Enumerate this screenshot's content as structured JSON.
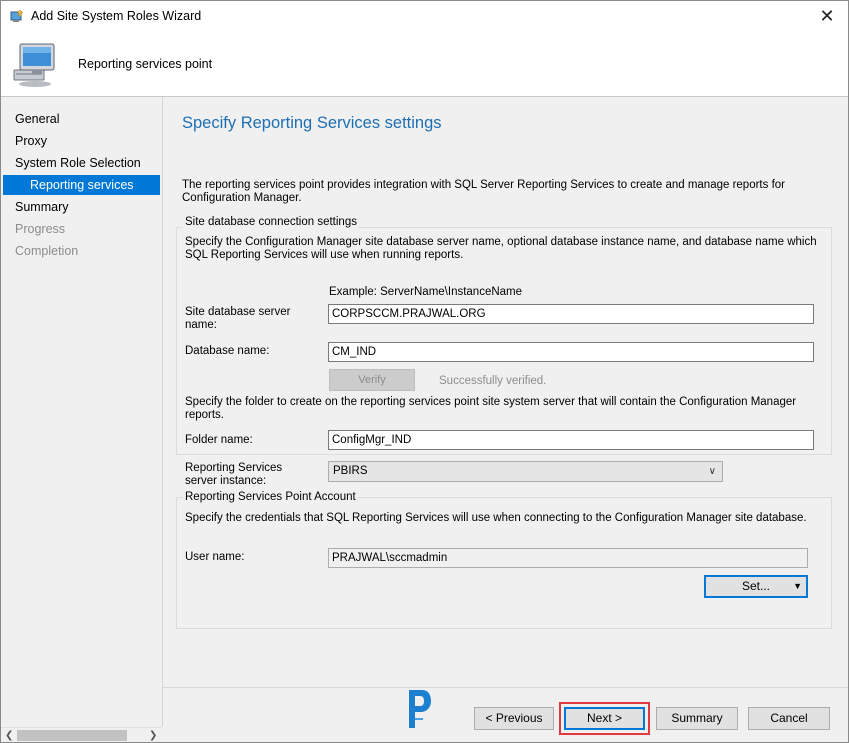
{
  "window": {
    "title": "Add Site System Roles Wizard",
    "close_glyph": "✕"
  },
  "header": {
    "title": "Reporting services point"
  },
  "sidebar": {
    "items": [
      {
        "label": "General",
        "state": "normal"
      },
      {
        "label": "Proxy",
        "state": "normal"
      },
      {
        "label": "System Role Selection",
        "state": "normal"
      },
      {
        "label": "Reporting services point",
        "state": "active"
      },
      {
        "label": "Summary",
        "state": "normal"
      },
      {
        "label": "Progress",
        "state": "disabled"
      },
      {
        "label": "Completion",
        "state": "disabled"
      }
    ]
  },
  "main": {
    "heading": "Specify Reporting Services settings",
    "description": "The reporting services point provides integration with SQL Server Reporting Services to create and manage reports for Configuration Manager.",
    "db_group": {
      "title": "Site database connection settings",
      "instructions": "Specify the Configuration Manager site database server name, optional database instance name, and database name which SQL Reporting Services will use when running reports.",
      "example": "Example: ServerName\\InstanceName",
      "server_label": "Site database server name:",
      "server_value": "CORPSCCM.PRAJWAL.ORG",
      "dbname_label": "Database name:",
      "dbname_value": "CM_IND",
      "verify_label": "Verify",
      "verify_status": "Successfully verified.",
      "folder_instructions": "Specify the folder to create on the reporting services point site system server that will contain the Configuration Manager reports.",
      "folder_label": "Folder name:",
      "folder_value": "ConfigMgr_IND"
    },
    "instance_label": "Reporting Services server instance:",
    "instance_value": "PBIRS",
    "account_group": {
      "title": "Reporting Services Point Account",
      "instructions": "Specify the credentials that SQL Reporting Services will use when connecting to the Configuration Manager site database.",
      "user_label": "User name:",
      "user_value": "PRAJWAL\\sccmadmin",
      "set_label": "Set..."
    }
  },
  "footer": {
    "previous": "< Previous",
    "next": "Next >",
    "summary": "Summary",
    "cancel": "Cancel"
  },
  "colors": {
    "accent": "#0078d7",
    "heading": "#1c6fb4",
    "highlight": "#e0393e"
  },
  "icons": [
    "wizard-app-icon",
    "computer-monitor-icon",
    "close-icon",
    "chevron-down-icon",
    "dropdown-arrow-icon",
    "site-logo-icon",
    "scroll-left-icon",
    "scroll-right-icon"
  ]
}
